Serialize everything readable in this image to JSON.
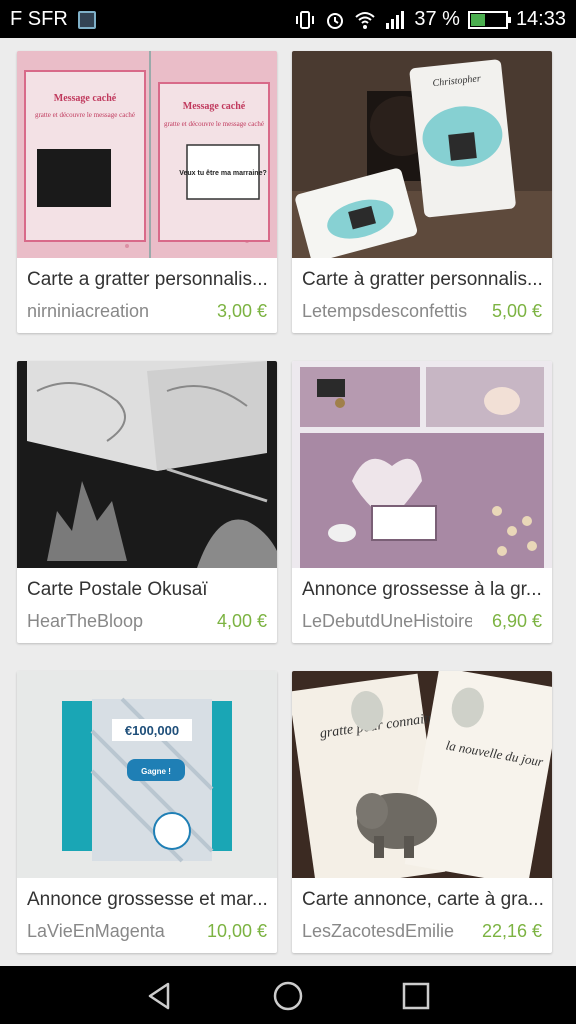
{
  "status": {
    "carrier": "F SFR",
    "battery_pct": "37 %",
    "time": "14:33"
  },
  "products": [
    {
      "title": "Carte a gratter personnalis...",
      "shop": "nirniniacreation",
      "price": "3,00 €"
    },
    {
      "title": "Carte à gratter personnalis...",
      "shop": "Letempsdesconfettis",
      "price": "5,00 €"
    },
    {
      "title": "Carte Postale Okusaï",
      "shop": "HearTheBloop",
      "price": "4,00 €"
    },
    {
      "title": "Annonce grossesse à la gr...",
      "shop": "LeDebutdUneHistoire",
      "price": "6,90 €"
    },
    {
      "title": "Annonce grossesse et mar...",
      "shop": "LaVieEnMagenta",
      "price": "10,00 €"
    },
    {
      "title": "Carte annonce, carte à gra...",
      "shop": "LesZacotesdEmilie",
      "price": "22,16 €"
    }
  ],
  "image_text": {
    "p1_left_heading": "Message caché",
    "p1_left_sub": "gratte et découvre le message caché",
    "p1_right_heading": "Message caché",
    "p1_right_sub": "gratte et découvre le message caché",
    "p1_right_box": "Veux tu être ma marraine?",
    "p2_name": "Christopher",
    "p5_amount": "€100,000",
    "p5_button": "Gagne !",
    "p6_left": "gratte pour connaitre",
    "p6_right": "la nouvelle du jour"
  },
  "icons": {
    "vibrate": "vibrate-icon",
    "alarm": "alarm-icon",
    "wifi": "wifi-icon",
    "signal": "signal-icon",
    "back": "back-icon",
    "home": "home-icon",
    "recents": "recents-icon"
  }
}
